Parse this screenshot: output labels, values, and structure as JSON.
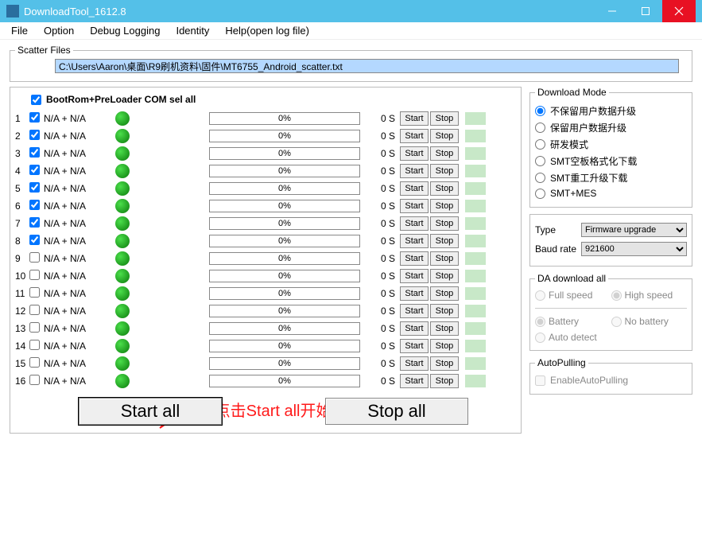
{
  "window": {
    "title": "DownloadTool_1612.8"
  },
  "menu": {
    "file": "File",
    "option": "Option",
    "debug": "Debug Logging",
    "identity": "Identity",
    "help": "Help(open log file)"
  },
  "scatter": {
    "legend": "Scatter Files",
    "path": "C:\\Users\\Aaron\\桌面\\R9刷机资料\\固件\\MT6755_Android_scatter.txt"
  },
  "portPanel": {
    "selAllLabel": "BootRom+PreLoader COM sel all",
    "startBtn": "Start",
    "stopBtn": "Stop",
    "rows": [
      {
        "idx": "1",
        "label": "N/A + N/A",
        "checked": true,
        "pct": "0%",
        "time": "0 S"
      },
      {
        "idx": "2",
        "label": "N/A + N/A",
        "checked": true,
        "pct": "0%",
        "time": "0 S"
      },
      {
        "idx": "3",
        "label": "N/A + N/A",
        "checked": true,
        "pct": "0%",
        "time": "0 S"
      },
      {
        "idx": "4",
        "label": "N/A + N/A",
        "checked": true,
        "pct": "0%",
        "time": "0 S"
      },
      {
        "idx": "5",
        "label": "N/A + N/A",
        "checked": true,
        "pct": "0%",
        "time": "0 S"
      },
      {
        "idx": "6",
        "label": "N/A + N/A",
        "checked": true,
        "pct": "0%",
        "time": "0 S"
      },
      {
        "idx": "7",
        "label": "N/A + N/A",
        "checked": true,
        "pct": "0%",
        "time": "0 S"
      },
      {
        "idx": "8",
        "label": "N/A + N/A",
        "checked": true,
        "pct": "0%",
        "time": "0 S"
      },
      {
        "idx": "9",
        "label": "N/A + N/A",
        "checked": false,
        "pct": "0%",
        "time": "0 S"
      },
      {
        "idx": "10",
        "label": "N/A + N/A",
        "checked": false,
        "pct": "0%",
        "time": "0 S"
      },
      {
        "idx": "11",
        "label": "N/A + N/A",
        "checked": false,
        "pct": "0%",
        "time": "0 S"
      },
      {
        "idx": "12",
        "label": "N/A + N/A",
        "checked": false,
        "pct": "0%",
        "time": "0 S"
      },
      {
        "idx": "13",
        "label": "N/A + N/A",
        "checked": false,
        "pct": "0%",
        "time": "0 S"
      },
      {
        "idx": "14",
        "label": "N/A + N/A",
        "checked": false,
        "pct": "0%",
        "time": "0 S"
      },
      {
        "idx": "15",
        "label": "N/A + N/A",
        "checked": false,
        "pct": "0%",
        "time": "0 S"
      },
      {
        "idx": "16",
        "label": "N/A + N/A",
        "checked": false,
        "pct": "0%",
        "time": "0 S"
      }
    ]
  },
  "downloadMode": {
    "legend": "Download Mode",
    "opts": [
      "不保留用户数据升级",
      "保留用户数据升级",
      "研发模式",
      "SMT空板格式化下载",
      "SMT重工升级下载",
      "SMT+MES"
    ],
    "selected": 0
  },
  "type": {
    "label": "Type",
    "value": "Firmware upgrade"
  },
  "baud": {
    "label": "Baud rate",
    "value": "921600"
  },
  "da": {
    "legend": "DA download all",
    "fullSpeed": "Full speed",
    "highSpeed": "High speed",
    "battery": "Battery",
    "noBattery": "No battery",
    "autoDetect": "Auto detect"
  },
  "autoPulling": {
    "legend": "AutoPulling",
    "label": "EnableAutoPulling"
  },
  "bigButtons": {
    "startAll": "Start all",
    "stopAll": "Stop all"
  },
  "annotation": {
    "text": "1.点击Start all开始刷机"
  }
}
